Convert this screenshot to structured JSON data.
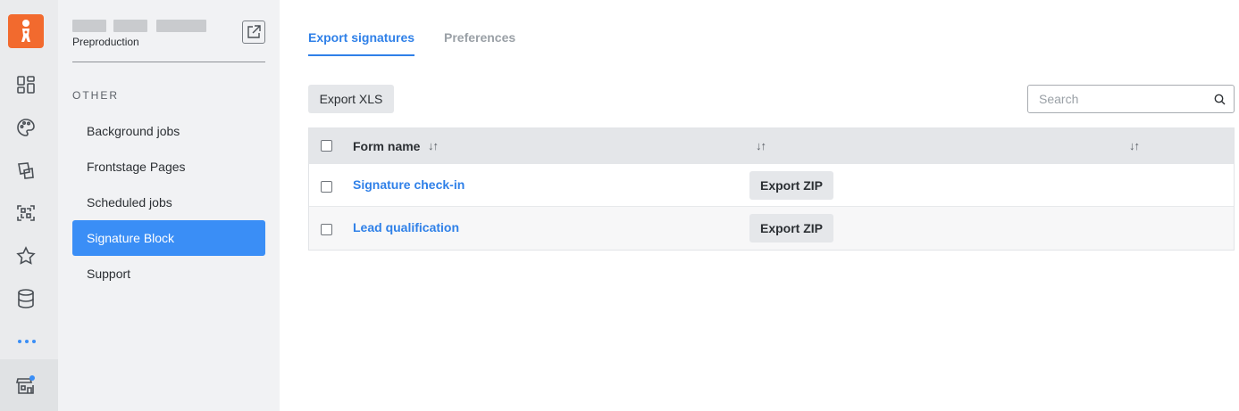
{
  "sidebar": {
    "workspace_env": "Preproduction",
    "section_label": "OTHER",
    "items": [
      {
        "label": "Background jobs"
      },
      {
        "label": "Frontstage Pages"
      },
      {
        "label": "Scheduled jobs"
      },
      {
        "label": "Signature Block"
      },
      {
        "label": "Support"
      }
    ],
    "active_item": "Signature Block"
  },
  "rail": {
    "icons": [
      "app-logo-icon",
      "dashboard-icon",
      "palette-icon",
      "shapes-icon",
      "scan-icon",
      "star-icon",
      "database-icon",
      "more-icon",
      "store-icon"
    ]
  },
  "tabs": [
    {
      "label": "Export signatures",
      "active": true
    },
    {
      "label": "Preferences",
      "active": false
    }
  ],
  "toolbar": {
    "export_xls_label": "Export XLS",
    "search_placeholder": "Search"
  },
  "table": {
    "columns": [
      {
        "label": "Form name",
        "sortable": true
      },
      {
        "label": "",
        "sortable": true
      },
      {
        "label": "",
        "sortable": true
      }
    ],
    "sort_glyph": "↓↑",
    "rows": [
      {
        "name": "Signature check-in",
        "action": "Export ZIP"
      },
      {
        "name": "Lead qualification",
        "action": "Export ZIP"
      }
    ]
  },
  "colors": {
    "accent": "#2f80e8",
    "active_nav": "#3a8ef6",
    "logo": "#f26a2e",
    "notification_dot": "#3a8ef6"
  }
}
